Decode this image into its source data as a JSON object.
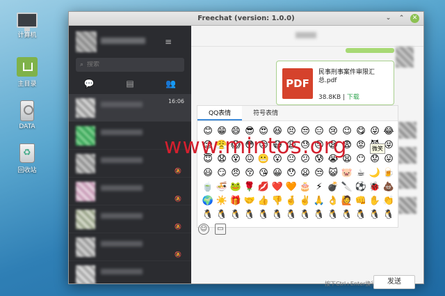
{
  "desktop": {
    "icons": [
      {
        "label": "计算机",
        "icon": "computer-icon"
      },
      {
        "label": "主目录",
        "icon": "home-folder-icon"
      },
      {
        "label": "DATA",
        "icon": "drive-icon"
      },
      {
        "label": "回收站",
        "icon": "trash-icon"
      }
    ]
  },
  "window": {
    "title": "Freechat (version: 1.0.0)",
    "controls": {
      "minimize": "⌄",
      "maximize": "⌃",
      "close": "✕"
    }
  },
  "sidebar": {
    "menu_icon": "≡",
    "search_placeholder": "搜索",
    "tabs": [
      {
        "icon": "chat-bubble-icon",
        "glyph": "💬"
      },
      {
        "icon": "contacts-icon",
        "glyph": "▤"
      },
      {
        "icon": "people-icon",
        "glyph": "👥"
      }
    ],
    "active_chat_time": "16:06"
  },
  "chat": {
    "file": {
      "type_label": "PDF",
      "name": "民事刑事案件审限汇总.pdf",
      "size": "38.8KB",
      "separator": " | ",
      "download": "下载"
    },
    "emoji_tabs": [
      "QQ表情",
      "符号表情"
    ],
    "tooltip": "微笑",
    "hint": "按下Ctrl+Enter换行",
    "send_label": "发送"
  },
  "emoji": [
    "😊",
    "😁",
    "😄",
    "😎",
    "😍",
    "😆",
    "😣",
    "😒",
    "😑",
    "😢",
    "😉",
    "😋",
    "😜",
    "😂",
    "😌",
    "😤",
    "😱",
    "😳",
    "😥",
    "😷",
    "😩",
    "😓",
    "😔",
    "😪",
    "😨",
    "😡",
    "😈",
    "😝",
    "😇",
    "😧",
    "😵",
    "😖",
    "😬",
    "😮",
    "😐",
    "😕",
    "😰",
    "😭",
    "😫",
    "😶",
    "😟",
    "😛",
    "😃",
    "😏",
    "😠",
    "😚",
    "😘",
    "😀",
    "😯",
    "😦",
    "😒",
    "😺",
    "🐷",
    "☕",
    "🌙",
    "🍺",
    "🍵",
    "🍜",
    "🐸",
    "🌹",
    "💋",
    "❤️",
    "🧡",
    "🎂",
    "⚡",
    "💣",
    "🔪",
    "⚽",
    "🐞",
    "💩",
    "🌍",
    "☀️",
    "🎁",
    "🤝",
    "👍",
    "👎",
    "🤞",
    "✌️",
    "🙏",
    "👌",
    "🙋",
    "👊",
    "✋",
    "👏",
    "🐧",
    "🐧",
    "🐧",
    "🐧",
    "🐧",
    "🐧",
    "🐧",
    "🐧",
    "🐧",
    "🐧",
    "🐧",
    "🐧",
    "🐧",
    "🐧"
  ],
  "watermark": "www.mintos.org"
}
